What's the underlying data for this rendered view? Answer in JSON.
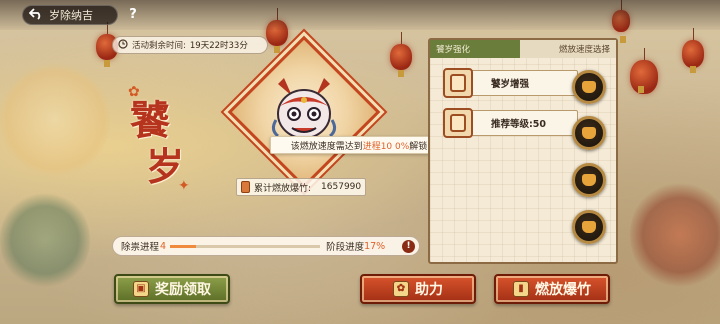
{
  "header": {
    "back_label": "岁除纳吉",
    "help_label": "?"
  },
  "timer": {
    "label": "活动剩余时间:",
    "value": "19天22时33分"
  },
  "title": {
    "char1": "饕",
    "char2": "岁"
  },
  "tooltip": {
    "prefix": "该燃放速度需达到",
    "highlight": "进程10 0%",
    "suffix": "解锁"
  },
  "firecracker": {
    "label": "累计燃放爆竹:",
    "value": "1657990"
  },
  "progress": {
    "label": "除祟进程",
    "value": "4",
    "fill": 0.17,
    "stage_label": "阶段进度",
    "stage_value": "17%",
    "info": "!"
  },
  "panel": {
    "tab_active": "饕岁强化",
    "tab_inactive": "燃放速度选择",
    "rows": [
      {
        "label": "饕岁增强"
      },
      {
        "label": "推荐等级:50"
      }
    ]
  },
  "buttons": {
    "reward": "奖励领取",
    "help": "助力",
    "fire": "燃放爆竹"
  },
  "colors": {
    "accent_red": "#b6341d",
    "highlight_orange": "#e0622b",
    "panel_green": "#6b7d3a"
  }
}
